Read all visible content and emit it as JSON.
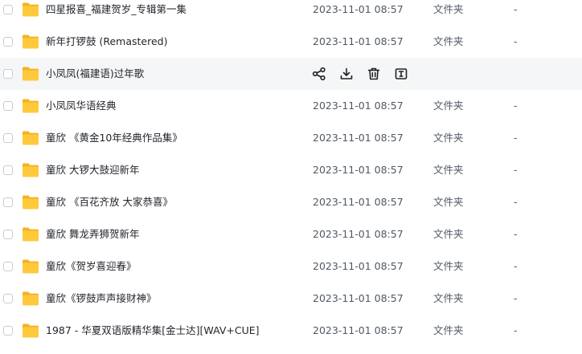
{
  "colors": {
    "folder": "#ffc93c",
    "folder_tab": "#f5b21f",
    "hover_row": "#f5f6f8",
    "text": "#1f2329",
    "meta_text": "#505866",
    "icon": "#1f2329"
  },
  "hover_actions": [
    {
      "name": "share-icon",
      "label": "share"
    },
    {
      "name": "download-icon",
      "label": "download"
    },
    {
      "name": "delete-icon",
      "label": "delete"
    },
    {
      "name": "rename-icon",
      "label": "rename"
    }
  ],
  "files": [
    {
      "name": "四星报喜_福建贺岁_专辑第一集",
      "date": "2023-11-01 08:57",
      "type": "文件夹",
      "size": "-"
    },
    {
      "name": "新年打锣鼓 (Remastered)",
      "date": "2023-11-01 08:57",
      "type": "文件夹",
      "size": "-"
    },
    {
      "name": "小凤凤(福建语)过年歌",
      "date": "",
      "type": "",
      "size": "",
      "hovered": true
    },
    {
      "name": "小凤凤华语经典",
      "date": "2023-11-01 08:57",
      "type": "文件夹",
      "size": "-"
    },
    {
      "name": "童欣 《黄金10年经典作品集》",
      "date": "2023-11-01 08:57",
      "type": "文件夹",
      "size": "-"
    },
    {
      "name": "童欣 大锣大鼓迎新年",
      "date": "2023-11-01 08:57",
      "type": "文件夹",
      "size": "-"
    },
    {
      "name": "童欣 《百花齐放 大家恭喜》",
      "date": "2023-11-01 08:57",
      "type": "文件夹",
      "size": "-"
    },
    {
      "name": "童欣 舞龙弄狮贺新年",
      "date": "2023-11-01 08:57",
      "type": "文件夹",
      "size": "-"
    },
    {
      "name": "童欣《贺岁喜迎春》",
      "date": "2023-11-01 08:57",
      "type": "文件夹",
      "size": "-"
    },
    {
      "name": "童欣《锣鼓声声接财神》",
      "date": "2023-11-01 08:57",
      "type": "文件夹",
      "size": "-"
    },
    {
      "name": "1987 - 华夏双语版精华集[金士达][WAV+CUE]",
      "date": "2023-11-01 08:57",
      "type": "文件夹",
      "size": "-"
    }
  ]
}
